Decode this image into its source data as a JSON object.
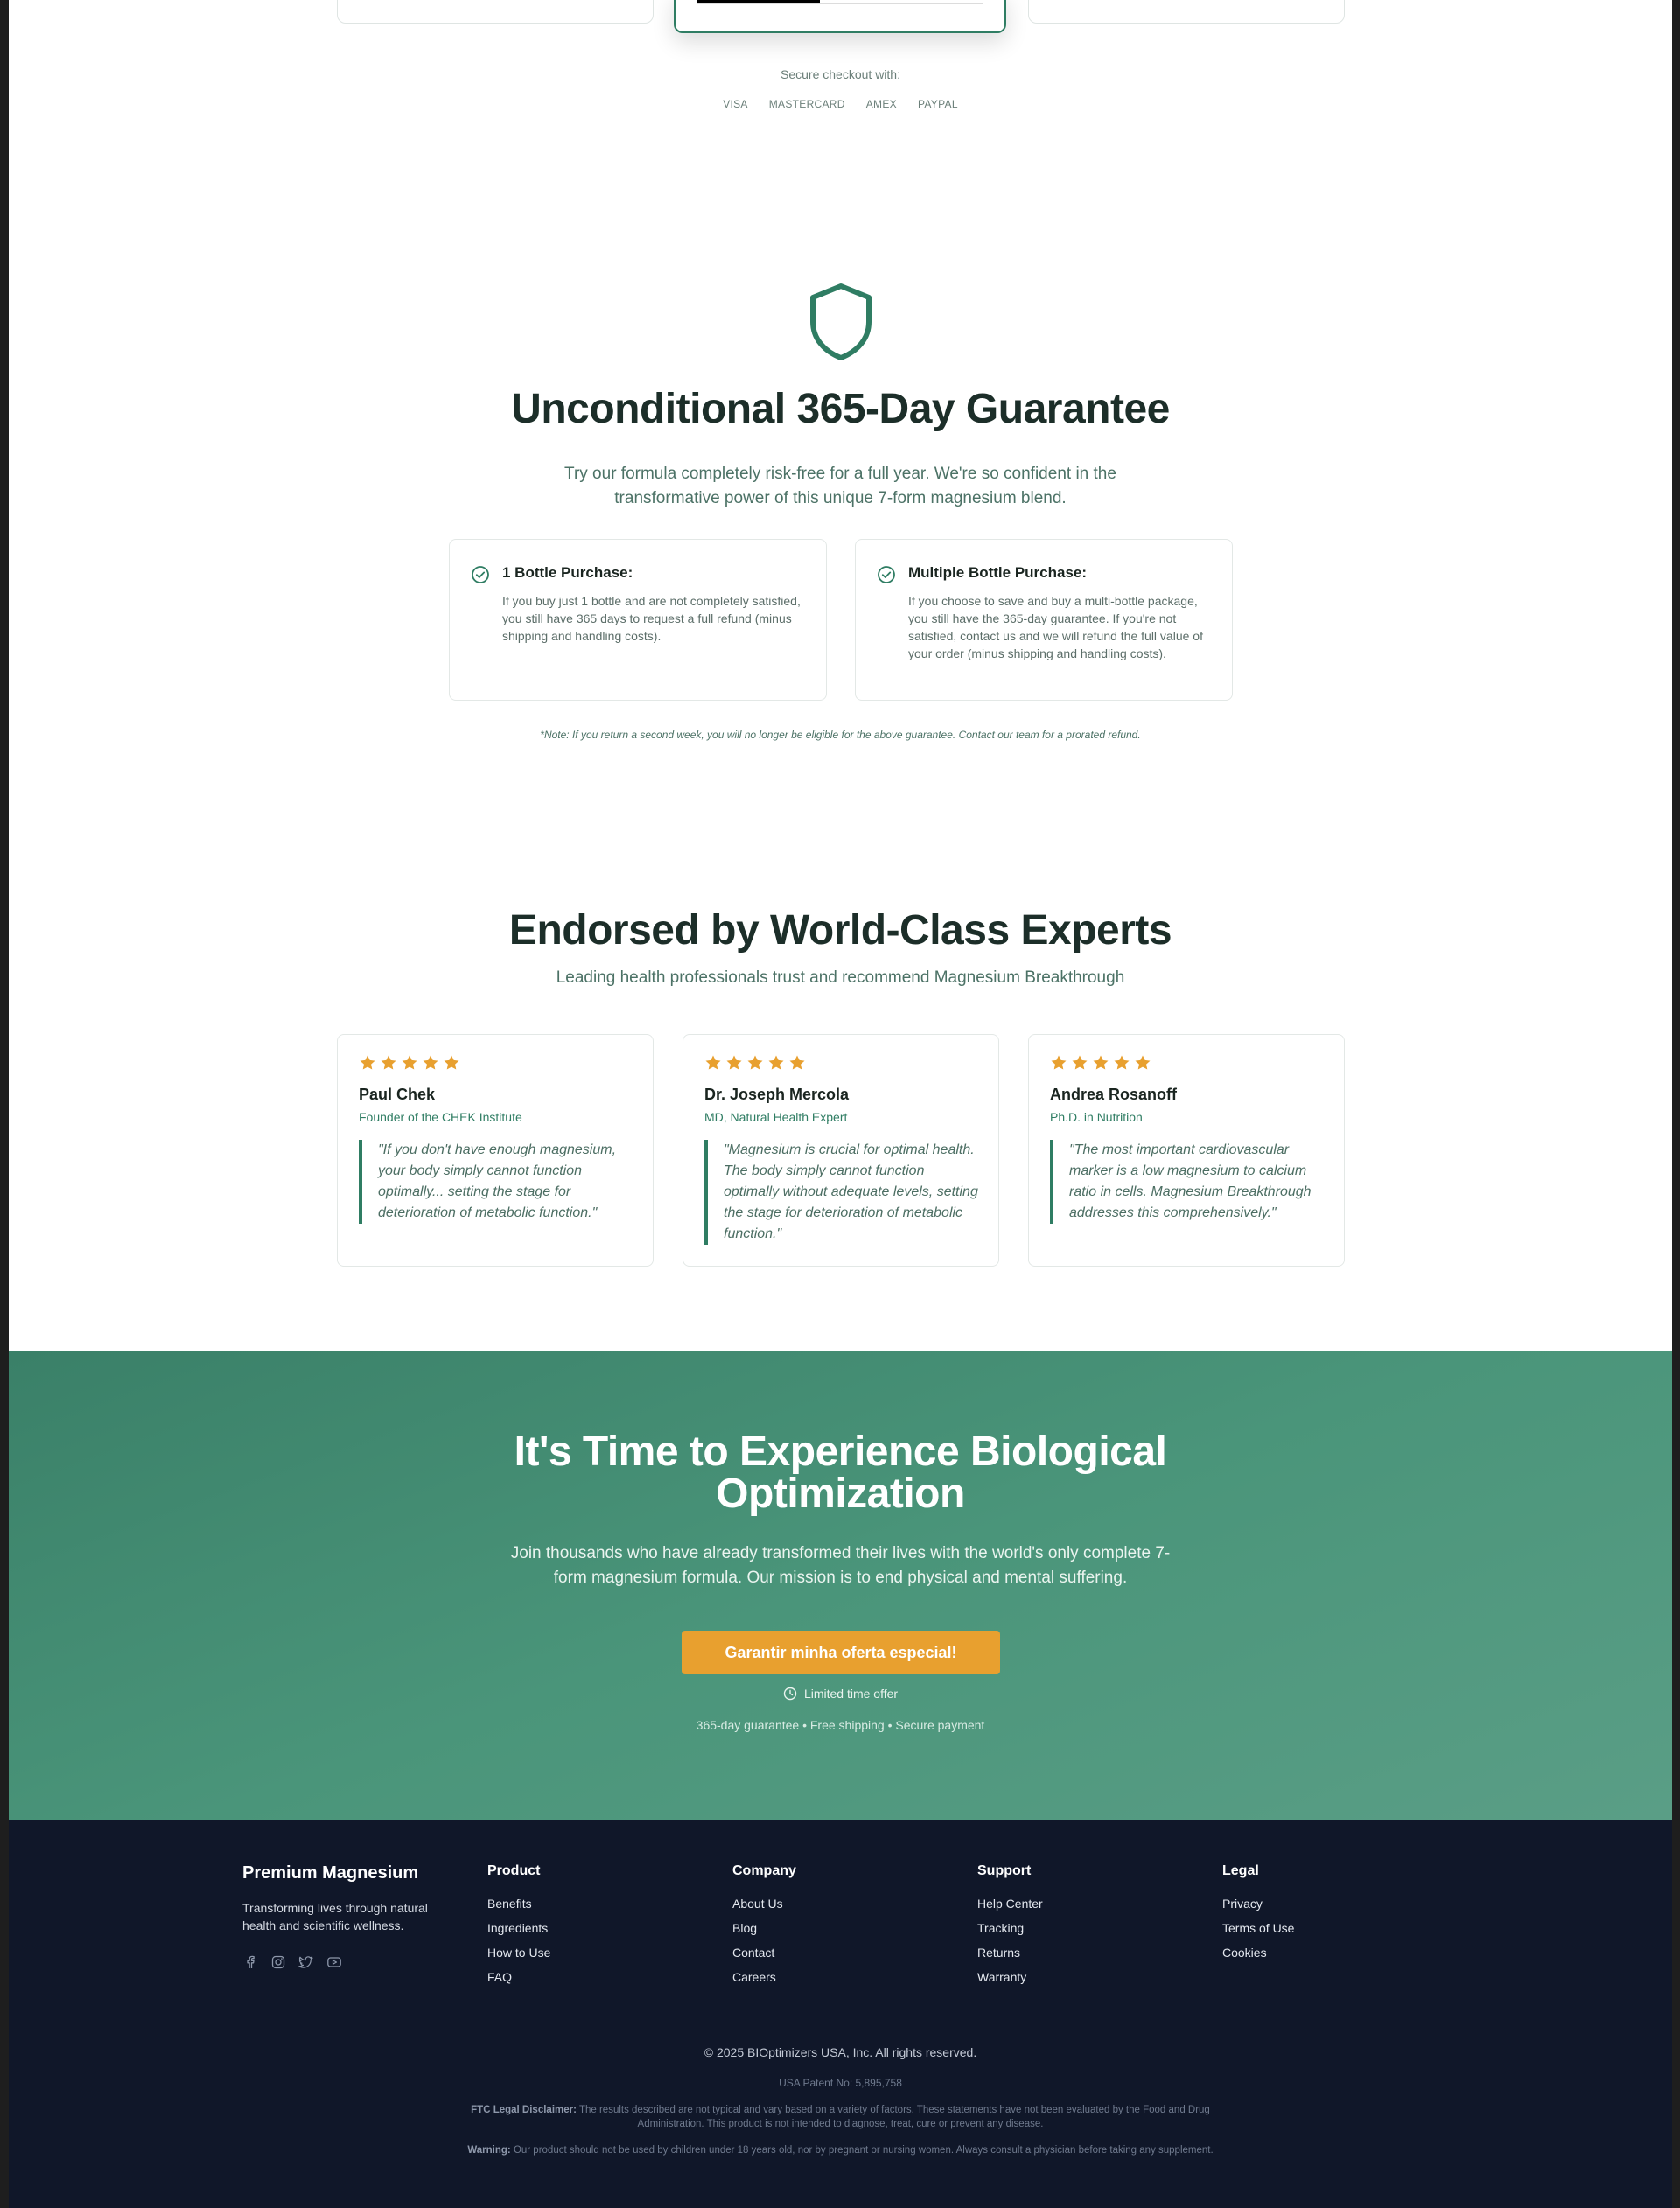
{
  "pricing_remnant": {
    "secure_checkout_label": "Secure checkout with:",
    "payment_methods": [
      "VISA",
      "MASTERCARD",
      "AMEX",
      "PAYPAL"
    ]
  },
  "guarantee": {
    "icon": "shield-icon",
    "title": "Unconditional 365-Day Guarantee",
    "subtitle": "Try our formula completely risk-free for a full year. We're so confident in the transformative power of this unique 7-form magnesium blend.",
    "cards": [
      {
        "icon": "check-circle-icon",
        "title": "1 Bottle Purchase:",
        "text": "If you buy just 1 bottle and are not completely satisfied, you still have 365 days to request a full refund (minus shipping and handling costs)."
      },
      {
        "icon": "check-circle-icon",
        "title": "Multiple Bottle Purchase:",
        "text": "If you choose to save and buy a multi-bottle package, you still have the 365-day guarantee. If you're not satisfied, contact us and we will refund the full value of your order (minus shipping and handling costs)."
      }
    ],
    "note": "*Note: If you return a second week, you will no longer be eligible for the above guarantee. Contact our team for a prorated refund."
  },
  "experts": {
    "title": "Endorsed by World-Class Experts",
    "subtitle": "Leading health professionals trust and recommend Magnesium Breakthrough",
    "rating": 5,
    "star_color": "#e8a02f",
    "cards": [
      {
        "name": "Paul Chek",
        "role": "Founder of the CHEK Institute",
        "quote": "\"If you don't have enough magnesium, your body simply cannot function optimally... setting the stage for deterioration of metabolic function.\""
      },
      {
        "name": "Dr. Joseph Mercola",
        "role": "MD, Natural Health Expert",
        "quote": "\"Magnesium is crucial for optimal health. The body simply cannot function optimally without adequate levels, setting the stage for deterioration of metabolic function.\""
      },
      {
        "name": "Andrea Rosanoff",
        "role": "Ph.D. in Nutrition",
        "quote": "\"The most important cardiovascular marker is a low magnesium to calcium ratio in cells. Magnesium Breakthrough addresses this comprehensively.\""
      }
    ]
  },
  "cta": {
    "title_line1": "It's Time to Experience Biological",
    "title_line2": "Optimization",
    "subtitle": "Join thousands who have already transformed their lives with the world's only complete 7-form magnesium formula. Our mission is to end physical and mental suffering.",
    "button_label": "Garantir minha oferta especial!",
    "limited_label": "Limited time offer",
    "limited_icon": "clock-icon",
    "perks": "365-day guarantee • Free shipping • Secure payment",
    "button_color": "#e8a02f",
    "background_color": "#3f8a70"
  },
  "footer": {
    "brand": "Premium Magnesium",
    "tagline": "Transforming lives through natural health and scientific wellness.",
    "social_icons": [
      "facebook-icon",
      "instagram-icon",
      "twitter-icon",
      "youtube-icon"
    ],
    "columns": {
      "product": {
        "title": "Product",
        "links": [
          "Benefits",
          "Ingredients",
          "How to Use",
          "FAQ"
        ]
      },
      "company": {
        "title": "Company",
        "links": [
          "About Us",
          "Blog",
          "Contact",
          "Careers"
        ]
      },
      "support": {
        "title": "Support",
        "links": [
          "Help Center",
          "Tracking",
          "Returns",
          "Warranty"
        ]
      },
      "legal": {
        "title": "Legal",
        "links": [
          "Privacy",
          "Terms of Use",
          "Cookies"
        ]
      }
    },
    "copyright": "© 2025 BIOptimizers USA, Inc. All rights reserved.",
    "patent": "USA Patent No: 5,895,758",
    "ftc_label": "FTC Legal Disclaimer:",
    "ftc_text": "The results described are not typical and vary based on a variety of factors. These statements have not been evaluated by the Food and Drug Administration. This product is not intended to diagnose, treat, cure or prevent any disease.",
    "warning_label": "Warning:",
    "warning_text": "Our product should not be used by children under 18 years old, nor by pregnant or nursing women. Always consult a physician before taking any supplement.",
    "background_color": "#101729"
  }
}
